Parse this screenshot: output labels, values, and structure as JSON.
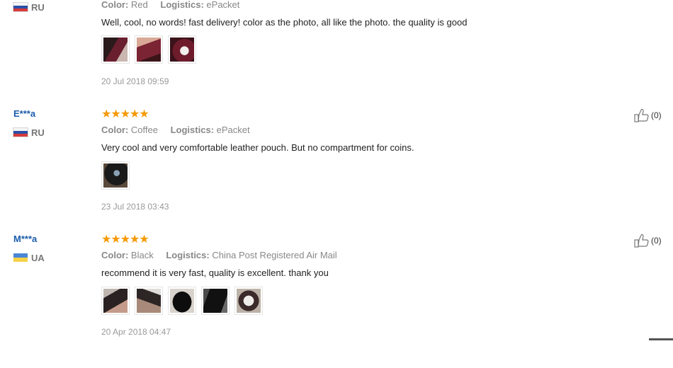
{
  "reviews": [
    {
      "user": "",
      "country": "RU",
      "stars": "★★★★★",
      "color_label": "Color:",
      "color_value": "Red",
      "logistics_label": "Logistics:",
      "logistics_value": "ePacket",
      "text": "Well, cool, no words! fast delivery! color as the photo, all like the photo. the quality is good",
      "date": "20 Jul 2018 09:59",
      "helpful": ""
    },
    {
      "user": "E***a",
      "country": "RU",
      "stars": "★★★★★",
      "color_label": "Color:",
      "color_value": "Coffee",
      "logistics_label": "Logistics:",
      "logistics_value": "ePacket",
      "text": "Very cool and very comfortable leather pouch. But no compartment for coins.",
      "date": "23 Jul 2018 03:43",
      "helpful": "(0)"
    },
    {
      "user": "M***a",
      "country": "UA",
      "stars": "★★★★★",
      "color_label": "Color:",
      "color_value": "Black",
      "logistics_label": "Logistics:",
      "logistics_value": "China Post Registered Air Mail",
      "text": "recommend it is very fast, quality is excellent. thank you",
      "date": "20 Apr 2018 04:47",
      "helpful": "(0)"
    }
  ],
  "icons": {
    "star": "star-icon",
    "thumbs_up": "thumbs-up-icon",
    "flag_ru": "flag-ru-icon",
    "flag_ua": "flag-ua-icon"
  },
  "colors": {
    "star": "#f59a05",
    "username": "#1a5dab",
    "meta": "#888888"
  }
}
